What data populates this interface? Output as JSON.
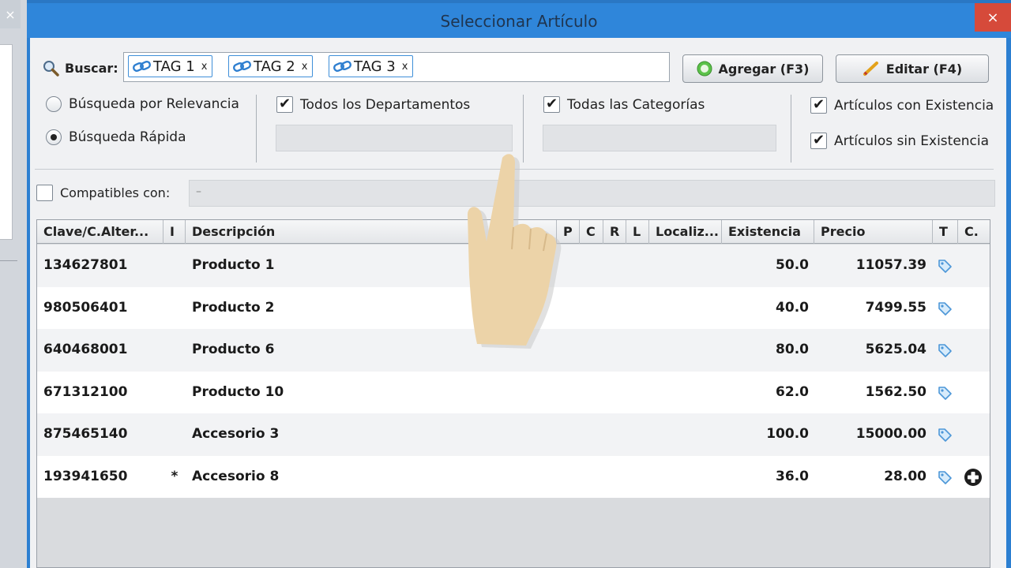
{
  "dialog": {
    "title": "Seleccionar Artículo",
    "close_label": "×"
  },
  "background_window": {
    "close_label": "×"
  },
  "search": {
    "label": "Buscar:",
    "tags": [
      {
        "text": "TAG 1",
        "remove": "x"
      },
      {
        "text": "TAG 2",
        "remove": "x"
      },
      {
        "text": "TAG 3",
        "remove": "x"
      }
    ]
  },
  "buttons": {
    "add_label": "Agregar (F3)",
    "edit_label": "Editar (F4)"
  },
  "options": {
    "relevance_label": "Búsqueda por Relevancia",
    "relevance_selected": false,
    "fast_label": "Búsqueda Rápida",
    "fast_selected": true,
    "all_departments_label": "Todos los Departamentos",
    "all_departments_checked": true,
    "all_categories_label": "Todas las Categorías",
    "all_categories_checked": true,
    "with_stock_label": "Artículos con Existencia",
    "with_stock_checked": true,
    "without_stock_label": "Artículos sin Existencia",
    "without_stock_checked": true
  },
  "compatibles": {
    "label": "Compatibles con:",
    "checked": false,
    "value": "–"
  },
  "table": {
    "headers": {
      "clave": "Clave/C.Alter...",
      "i": "I",
      "descripcion": "Descripción",
      "p": "P",
      "c": "C",
      "r": "R",
      "l": "L",
      "localizacion": "Localiz...",
      "existencia": "Existencia",
      "precio": "Precio",
      "t": "T",
      "c2": "C."
    },
    "rows": [
      {
        "clave": "134627801",
        "i": "",
        "descripcion": "Producto 1",
        "existencia": "50.0",
        "precio": "11057.39",
        "t_icon": "tag-icon",
        "c_icon": ""
      },
      {
        "clave": "980506401",
        "i": "",
        "descripcion": "Producto 2",
        "existencia": "40.0",
        "precio": "7499.55",
        "t_icon": "tag-icon",
        "c_icon": ""
      },
      {
        "clave": "640468001",
        "i": "",
        "descripcion": "Producto 6",
        "existencia": "80.0",
        "precio": "5625.04",
        "t_icon": "tag-icon",
        "c_icon": ""
      },
      {
        "clave": "671312100",
        "i": "",
        "descripcion": "Producto 10",
        "existencia": "62.0",
        "precio": "1562.50",
        "t_icon": "tag-icon",
        "c_icon": ""
      },
      {
        "clave": "875465140",
        "i": "",
        "descripcion": "Accesorio 3",
        "existencia": "100.0",
        "precio": "15000.00",
        "t_icon": "tag-icon",
        "c_icon": ""
      },
      {
        "clave": "193941650",
        "i": "*",
        "descripcion": "Accesorio 8",
        "existencia": "36.0",
        "precio": "28.00",
        "t_icon": "tag-icon",
        "c_icon": "plus-circle-icon"
      }
    ]
  },
  "colors": {
    "title_bar": "#2f86da",
    "close_button": "#d64a3a",
    "tag_border": "#3f8fd9"
  }
}
